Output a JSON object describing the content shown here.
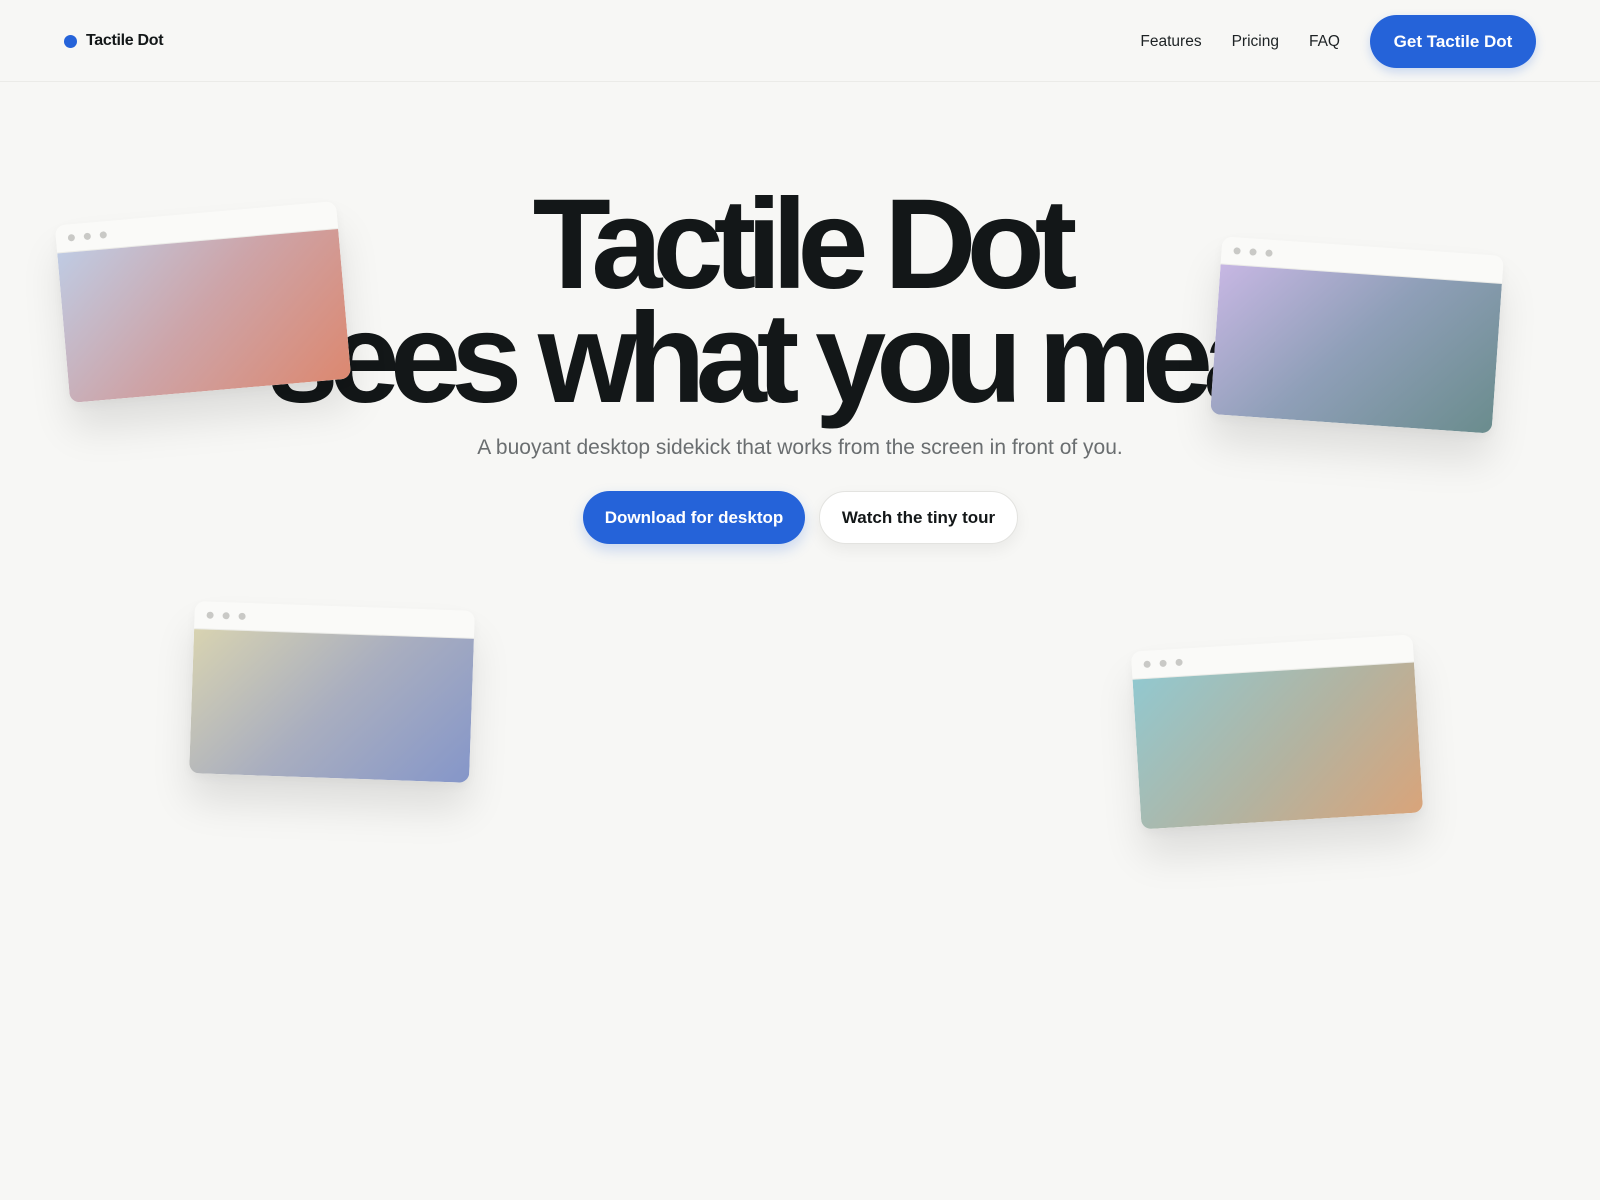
{
  "header": {
    "brand_name": "Tactile Dot",
    "nav": [
      {
        "label": "Features"
      },
      {
        "label": "Pricing"
      },
      {
        "label": "FAQ"
      }
    ],
    "cta_label": "Get Tactile Dot"
  },
  "hero": {
    "title_line1": "Tactile Dot",
    "title_line2": "sees what you mean",
    "subtitle": "A buoyant desktop sidekick that works from the screen in front of you.",
    "primary_label": "Download for desktop",
    "secondary_label": "Watch the tiny tour"
  },
  "colors": {
    "accent": "#2563d9",
    "background": "#f7f7f5",
    "text": "#131718",
    "muted_text": "#6a6e70"
  },
  "icons": {
    "brand": "blue-dot-icon",
    "window_controls": "window-dots-icon"
  }
}
